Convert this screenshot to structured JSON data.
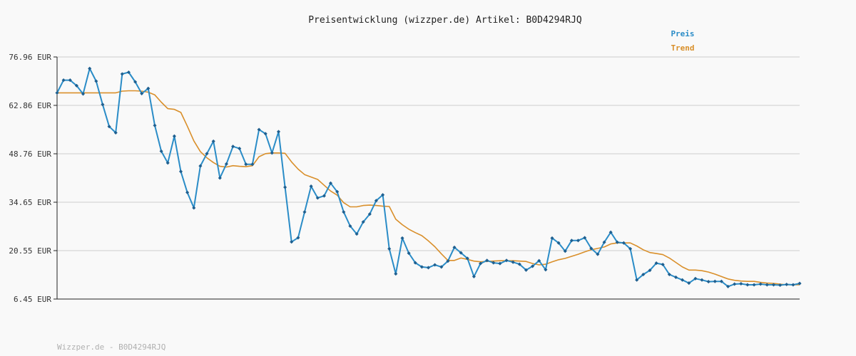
{
  "chart_data": {
    "type": "line",
    "title": "Preisentwicklung (wizzper.de) Artikel: B0D4294RJQ",
    "xlabel": "",
    "ylabel": "",
    "ylim": [
      6.45,
      76.96
    ],
    "yticks": [
      "76.96 EUR",
      "62.86 EUR",
      "48.76 EUR",
      "34.65 EUR",
      "20.55 EUR",
      "6.45 EUR"
    ],
    "ytick_values": [
      76.96,
      62.86,
      48.76,
      34.65,
      20.55,
      6.45
    ],
    "grid": true,
    "legend_position": "top-right",
    "footer": "Wizzper.de - B0D4294RJQ",
    "series": [
      {
        "name": "Preis",
        "color": "#2a8cc7",
        "markers": true,
        "values": [
          66.5,
          70.2,
          70.2,
          68.6,
          66.2,
          73.6,
          69.9,
          63.1,
          56.7,
          54.9,
          72.0,
          72.5,
          69.7,
          66.3,
          67.8,
          57.0,
          49.5,
          46.1,
          53.9,
          43.6,
          37.5,
          33.0,
          45.2,
          48.8,
          52.4,
          41.7,
          45.8,
          50.9,
          50.3,
          45.7,
          45.7,
          55.8,
          54.6,
          49.0,
          55.2,
          39.0,
          23.1,
          24.3,
          31.8,
          39.3,
          35.9,
          36.5,
          40.2,
          37.7,
          31.8,
          27.7,
          25.4,
          28.9,
          31.2,
          35.1,
          36.8,
          21.1,
          13.8,
          24.2,
          19.8,
          17.0,
          15.8,
          15.6,
          16.4,
          15.8,
          17.5,
          21.5,
          19.9,
          18.3,
          13.0,
          16.8,
          17.7,
          17.0,
          16.8,
          17.7,
          17.2,
          16.6,
          14.9,
          16.0,
          17.6,
          15.0,
          24.2,
          22.8,
          20.4,
          23.5,
          23.5,
          24.3,
          21.2,
          19.5,
          23.0,
          25.9,
          23.0,
          22.8,
          21.1,
          12.0,
          13.6,
          14.8,
          16.9,
          16.5,
          13.6,
          12.8,
          12.0,
          11.1,
          12.4,
          12.0,
          11.5,
          11.6,
          11.6,
          10.1,
          10.8,
          10.9,
          10.6,
          10.6,
          10.8,
          10.6,
          10.6,
          10.5,
          10.7,
          10.6,
          11.0
        ]
      },
      {
        "name": "Trend",
        "color": "#d98f2a",
        "markers": false,
        "values": [
          66.5,
          66.5,
          66.5,
          66.5,
          66.5,
          66.5,
          66.5,
          66.5,
          66.5,
          66.5,
          67.0,
          67.1,
          67.1,
          67.0,
          66.7,
          65.9,
          63.8,
          61.9,
          61.7,
          60.8,
          56.8,
          52.5,
          49.4,
          47.6,
          46.2,
          45.1,
          44.9,
          45.3,
          45.1,
          45.0,
          45.3,
          47.9,
          48.8,
          49.0,
          49.0,
          48.9,
          46.4,
          44.3,
          42.7,
          42.0,
          41.3,
          39.6,
          37.9,
          36.7,
          34.5,
          33.3,
          33.3,
          33.7,
          33.8,
          33.7,
          33.5,
          33.4,
          29.7,
          28.1,
          26.8,
          25.8,
          24.9,
          23.4,
          21.7,
          19.6,
          17.7,
          17.7,
          18.4,
          18.0,
          17.5,
          17.3,
          17.4,
          17.5,
          17.6,
          17.6,
          17.6,
          17.5,
          17.4,
          16.8,
          16.4,
          16.6,
          17.3,
          17.9,
          18.3,
          18.9,
          19.5,
          20.2,
          20.8,
          21.2,
          21.6,
          22.5,
          22.8,
          22.8,
          22.8,
          21.9,
          20.8,
          20.0,
          19.7,
          19.4,
          18.4,
          17.1,
          15.8,
          14.9,
          14.9,
          14.7,
          14.3,
          13.7,
          13.0,
          12.3,
          11.9,
          11.7,
          11.6,
          11.6,
          11.3,
          11.1,
          11.0,
          10.8,
          10.6,
          10.6,
          10.6
        ]
      }
    ]
  }
}
